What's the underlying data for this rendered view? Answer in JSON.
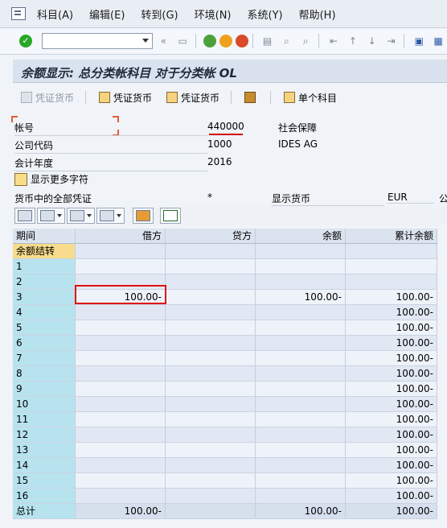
{
  "menubar": {
    "items": [
      "科目(A)",
      "编辑(E)",
      "转到(G)",
      "环境(N)",
      "系统(Y)",
      "帮助(H)"
    ]
  },
  "toolbar": {
    "command_value": "",
    "nav_back_glyph": "«"
  },
  "title": "余额显示: 总分类帐科目 对于分类帐 OL",
  "app_toolbar": {
    "buttons": [
      "凭证货币",
      "凭证货币",
      "凭证货币",
      "单个科目"
    ]
  },
  "form": {
    "account_label": "帐号",
    "account_value": "440000",
    "account_desc": "社会保障",
    "company_label": "公司代码",
    "company_value": "1000",
    "company_desc": "IDES AG",
    "year_label": "会计年度",
    "year_value": "2016",
    "more_chars": "显示更多字符",
    "currency_label": "货币中的全部凭证",
    "currency_value": "*",
    "display_currency_label": "显示货币",
    "display_currency_value": "EUR",
    "cut_text": "公"
  },
  "grid": {
    "headers": [
      "期间",
      "借方",
      "贷方",
      "余额",
      "累计余额"
    ],
    "rows": [
      [
        "余额结转",
        "",
        "",
        "",
        ""
      ],
      [
        "1",
        "",
        "",
        "",
        ""
      ],
      [
        "2",
        "",
        "",
        "",
        ""
      ],
      [
        "3",
        "100.00-",
        "",
        "100.00-",
        "100.00-"
      ],
      [
        "4",
        "",
        "",
        "",
        "100.00-"
      ],
      [
        "5",
        "",
        "",
        "",
        "100.00-"
      ],
      [
        "6",
        "",
        "",
        "",
        "100.00-"
      ],
      [
        "7",
        "",
        "",
        "",
        "100.00-"
      ],
      [
        "8",
        "",
        "",
        "",
        "100.00-"
      ],
      [
        "9",
        "",
        "",
        "",
        "100.00-"
      ],
      [
        "10",
        "",
        "",
        "",
        "100.00-"
      ],
      [
        "11",
        "",
        "",
        "",
        "100.00-"
      ],
      [
        "12",
        "",
        "",
        "",
        "100.00-"
      ],
      [
        "13",
        "",
        "",
        "",
        "100.00-"
      ],
      [
        "14",
        "",
        "",
        "",
        "100.00-"
      ],
      [
        "15",
        "",
        "",
        "",
        "100.00-"
      ],
      [
        "16",
        "",
        "",
        "",
        "100.00-"
      ]
    ],
    "total": [
      "总计",
      "100.00-",
      "",
      "100.00-",
      "100.00-"
    ]
  }
}
